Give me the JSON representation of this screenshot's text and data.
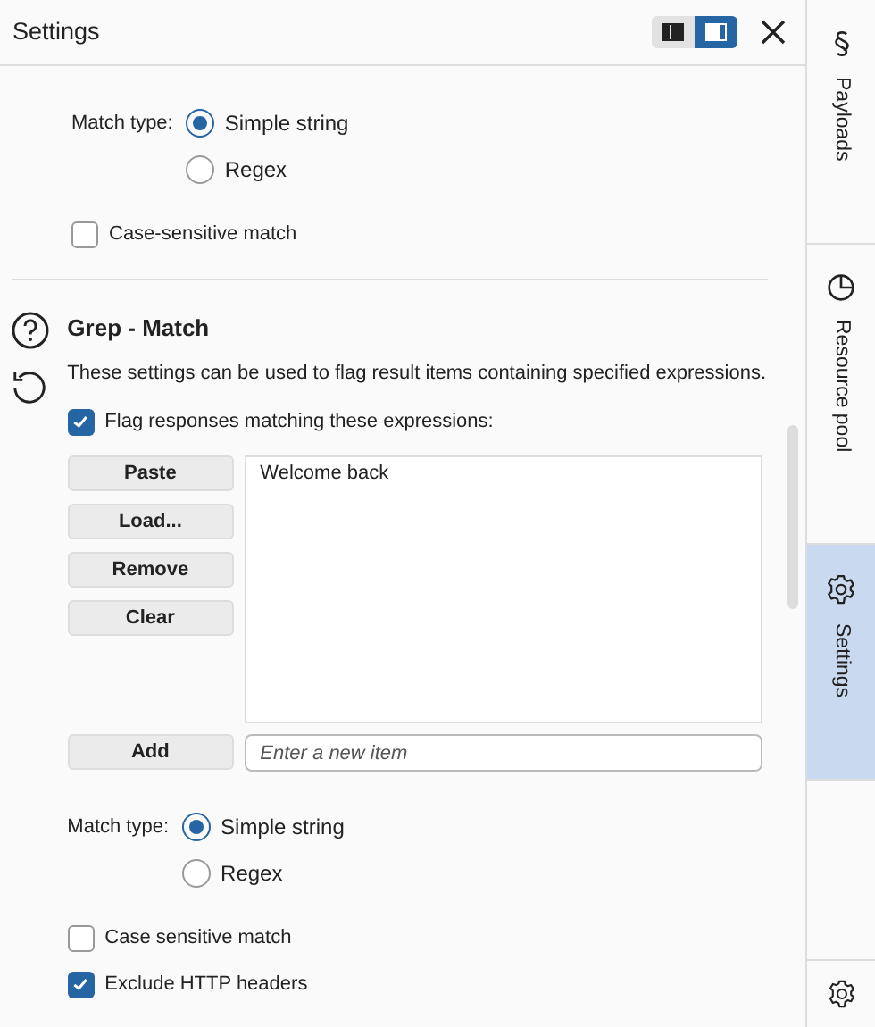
{
  "header": {
    "title": "Settings",
    "layout_toggle": [
      {
        "selected": false
      },
      {
        "selected": true
      }
    ]
  },
  "top_section": {
    "match_type": {
      "label": "Match type:",
      "options": [
        {
          "label": "Simple string",
          "selected": true
        },
        {
          "label": "Regex",
          "selected": false
        }
      ]
    },
    "options": [
      {
        "label": "Case-sensitive match",
        "checked": false
      }
    ]
  },
  "grep_match": {
    "title": "Grep - Match",
    "description": "These settings can be used to flag result items containing specified expressions.",
    "flag": {
      "label": "Flag responses matching these expressions:",
      "checked": true
    },
    "buttons": [
      "Paste",
      "Load...",
      "Remove",
      "Clear"
    ],
    "items": [
      "Welcome back"
    ],
    "add_button": "Add",
    "new_item": {
      "placeholder": "Enter a new item"
    },
    "match_type": {
      "label": "Match type:",
      "options": [
        {
          "label": "Simple string",
          "selected": true
        },
        {
          "label": "Regex",
          "selected": false
        }
      ]
    },
    "options": [
      {
        "label": "Case sensitive match",
        "checked": false
      },
      {
        "label": "Exclude HTTP headers",
        "checked": true
      }
    ]
  },
  "sidebar": {
    "tabs": [
      {
        "label": "Payloads",
        "selected": false
      },
      {
        "label": "Resource pool",
        "selected": false
      },
      {
        "label": "Settings",
        "selected": true
      }
    ]
  }
}
